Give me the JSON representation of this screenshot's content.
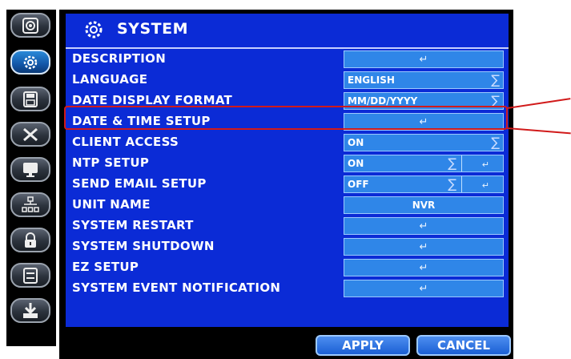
{
  "header": {
    "title": "SYSTEM"
  },
  "sidebar": {
    "items": [
      {
        "name": "camera-icon"
      },
      {
        "name": "gear-icon",
        "active": true
      },
      {
        "name": "save-icon"
      },
      {
        "name": "tools-icon"
      },
      {
        "name": "monitor-icon"
      },
      {
        "name": "network-icon"
      },
      {
        "name": "lock-icon"
      },
      {
        "name": "storage-icon"
      },
      {
        "name": "download-icon"
      }
    ]
  },
  "rows": [
    {
      "label": "DESCRIPTION",
      "control": "button"
    },
    {
      "label": "LANGUAGE",
      "control": "select",
      "value": "ENGLISH"
    },
    {
      "label": "DATE DISPLAY FORMAT",
      "control": "select",
      "value": "MM/DD/YYYY"
    },
    {
      "label": "DATE & TIME SETUP",
      "control": "button"
    },
    {
      "label": "CLIENT ACCESS",
      "control": "select",
      "value": "ON"
    },
    {
      "label": "NTP SETUP",
      "control": "select+button",
      "value": "ON"
    },
    {
      "label": "SEND EMAIL SETUP",
      "control": "select+button",
      "value": "OFF"
    },
    {
      "label": "UNIT NAME",
      "control": "text",
      "value": "NVR"
    },
    {
      "label": "SYSTEM RESTART",
      "control": "button"
    },
    {
      "label": "SYSTEM SHUTDOWN",
      "control": "button"
    },
    {
      "label": "EZ SETUP",
      "control": "button"
    },
    {
      "label": "SYSTEM EVENT NOTIFICATION",
      "control": "button"
    }
  ],
  "footer": {
    "apply_label": "APPLY",
    "cancel_label": "CANCEL"
  },
  "colors": {
    "panel_blue": "#0b2bd6",
    "control_blue": "#2f86e8",
    "highlight_red": "#d11a1a",
    "background": "#000000"
  }
}
